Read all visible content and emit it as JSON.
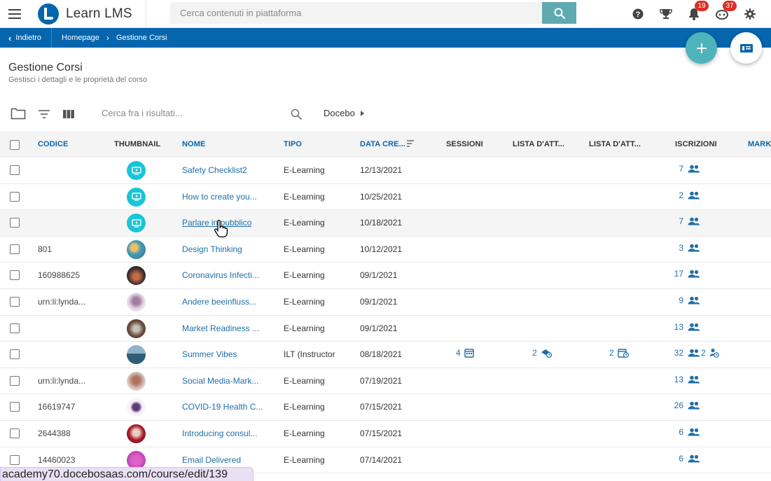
{
  "app": {
    "name": "Learn LMS"
  },
  "topbar": {
    "search_placeholder": "Cerca contenuti in piattaforma",
    "notifications_count": "19",
    "messages_count": "37"
  },
  "breadcrumb": {
    "back_label": "Indietro",
    "items": [
      "Homepage",
      "Gestione Corsi"
    ]
  },
  "page": {
    "title": "Gestione Corsi",
    "subtitle": "Gestisci i dettagli e le proprietà del corso"
  },
  "toolbar": {
    "search_placeholder": "Cerca fra i risultati...",
    "branch_label": "Docebo"
  },
  "table": {
    "columns": [
      "CODICE",
      "THUMBNAIL",
      "NOME",
      "TIPO",
      "DATA CRE...",
      "SESSIONI",
      "LISTA D'ATT...",
      "LISTA D'ATT...",
      "ISCRIZIONI",
      "MARK"
    ],
    "rows": [
      {
        "code": "",
        "thumb": "teal",
        "name": "Safety Checklist2",
        "type": "E-Learning",
        "date": "12/13/2021",
        "enrollments": "7"
      },
      {
        "code": "",
        "thumb": "teal",
        "name": "How to create you...",
        "type": "E-Learning",
        "date": "10/25/2021",
        "enrollments": "2"
      },
      {
        "code": "",
        "thumb": "teal",
        "name": "Parlare in pubblico",
        "type": "E-Learning",
        "date": "10/18/2021",
        "enrollments": "7"
      },
      {
        "code": "801",
        "thumb": "photo1",
        "name": "Design Thinking",
        "type": "E-Learning",
        "date": "10/12/2021",
        "enrollments": "3"
      },
      {
        "code": "160988625",
        "thumb": "photo2",
        "name": "Coronavirus Infecti...",
        "type": "E-Learning",
        "date": "09/1/2021",
        "enrollments": "17"
      },
      {
        "code": "urn:li:lynda...",
        "thumb": "photo3",
        "name": "Andere beeinfluss...",
        "type": "E-Learning",
        "date": "09/1/2021",
        "enrollments": "9"
      },
      {
        "code": "",
        "thumb": "photo4",
        "name": "Market Readiness ...",
        "type": "E-Learning",
        "date": "09/1/2021",
        "enrollments": "13"
      },
      {
        "code": "",
        "thumb": "photo5",
        "name": "Summer Vibes",
        "type": "ILT (Instructor",
        "date": "08/18/2021",
        "sessions": "4",
        "waitlist1": "2",
        "waitlist2": "2",
        "enrollments": "32",
        "extra": "2"
      },
      {
        "code": "urn:li:lynda...",
        "thumb": "photo6",
        "name": "Social Media-Mark...",
        "type": "E-Learning",
        "date": "07/19/2021",
        "enrollments": "13"
      },
      {
        "code": "16619747",
        "thumb": "photo7",
        "name": "COVID-19 Health C...",
        "type": "E-Learning",
        "date": "07/15/2021",
        "enrollments": "26"
      },
      {
        "code": "2644388",
        "thumb": "photo8",
        "name": "Introducing consul...",
        "type": "E-Learning",
        "date": "07/15/2021",
        "enrollments": "6"
      },
      {
        "code": "14460023",
        "thumb": "photo9",
        "name": "Email Delivered",
        "type": "E-Learning",
        "date": "07/14/2021",
        "enrollments": "6"
      }
    ]
  },
  "status_url": "academy70.docebosaas.com/course/edit/139",
  "colors": {
    "brand": "#0565ad",
    "accent": "#4fb3bb",
    "link": "#1f6fa8",
    "badge": "#d93128"
  }
}
